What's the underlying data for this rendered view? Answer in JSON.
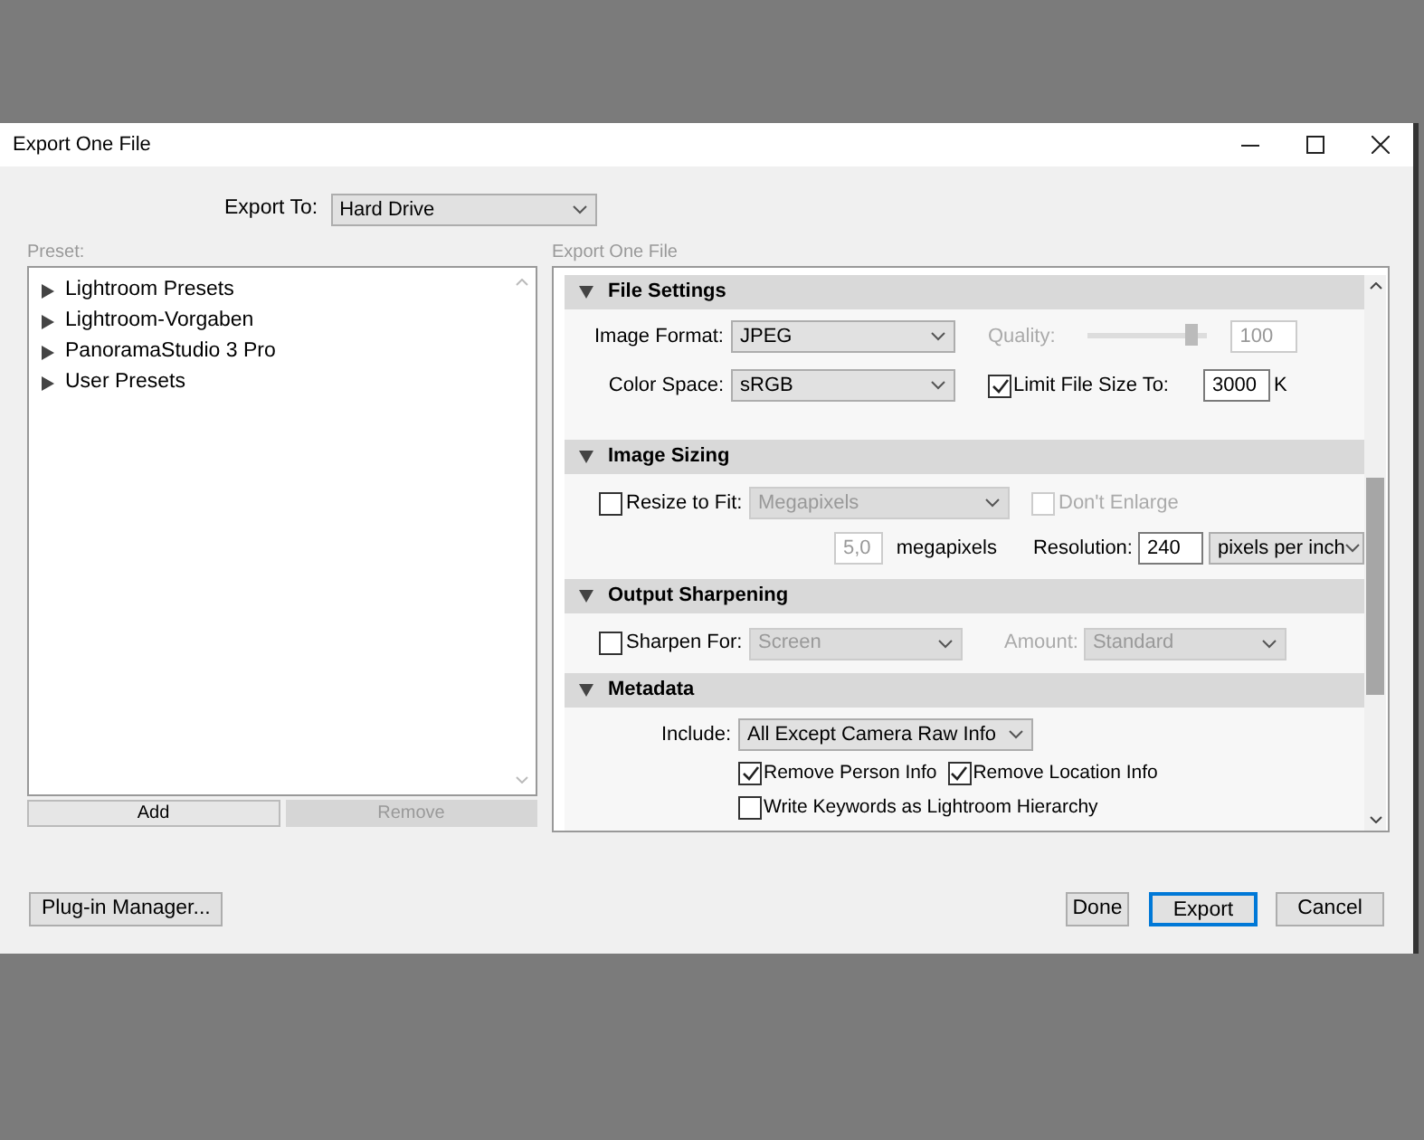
{
  "window": {
    "title": "Export One File"
  },
  "export_to": {
    "label": "Export To:",
    "value": "Hard Drive"
  },
  "preset": {
    "label": "Preset:",
    "items": [
      {
        "label": "Lightroom Presets",
        "expanded": false
      },
      {
        "label": "Lightroom-Vorgaben",
        "expanded": false
      },
      {
        "label": "PanoramaStudio 3 Pro",
        "expanded": false
      },
      {
        "label": "User Presets",
        "expanded": false
      }
    ],
    "buttons": [
      {
        "label": "Add",
        "disabled": false
      },
      {
        "label": "Remove",
        "disabled": true
      }
    ]
  },
  "settings": {
    "label": "Export One File",
    "sections": [
      {
        "title": "File Settings",
        "expanded": true
      },
      {
        "title": "Image Sizing",
        "expanded": true
      },
      {
        "title": "Output Sharpening",
        "expanded": true
      },
      {
        "title": "Metadata",
        "expanded": true
      }
    ],
    "file_settings": {
      "image_format_label": "Image Format:",
      "image_format": "JPEG",
      "quality_label": "Quality:",
      "quality": {
        "level": 0.87,
        "disabled": true
      },
      "quality_value": "100",
      "color_space_label": "Color Space:",
      "color_space": "sRGB",
      "limit": {
        "label": "Limit File Size To:",
        "checked": true
      },
      "limit_value": "3000",
      "limit_unit": "K"
    },
    "image_sizing": {
      "resize": {
        "label": "Resize to Fit:",
        "checked": false
      },
      "resize_mode": "Megapixels",
      "dont_enlarge": {
        "label": "Don't Enlarge",
        "checked": false,
        "disabled": true
      },
      "megapixels_value": "5,0",
      "megapixels_label": "megapixels",
      "resolution_label": "Resolution:",
      "resolution_value": "240",
      "resolution_unit": "pixels per inch"
    },
    "output_sharpening": {
      "sharpen": {
        "label": "Sharpen For:",
        "checked": false
      },
      "sharpen_for": "Screen",
      "amount_label": "Amount:",
      "amount": "Standard"
    },
    "metadata": {
      "include_label": "Include:",
      "include": "All Except Camera Raw Info",
      "options": [
        {
          "label": "Remove Person Info",
          "checked": true
        },
        {
          "label": "Remove Location Info",
          "checked": true
        },
        {
          "label": "Write Keywords as Lightroom Hierarchy",
          "checked": false
        }
      ]
    }
  },
  "buttons": {
    "plugin": "Plug-in Manager...",
    "done": "Done",
    "export": "Export",
    "cancel": "Cancel"
  }
}
